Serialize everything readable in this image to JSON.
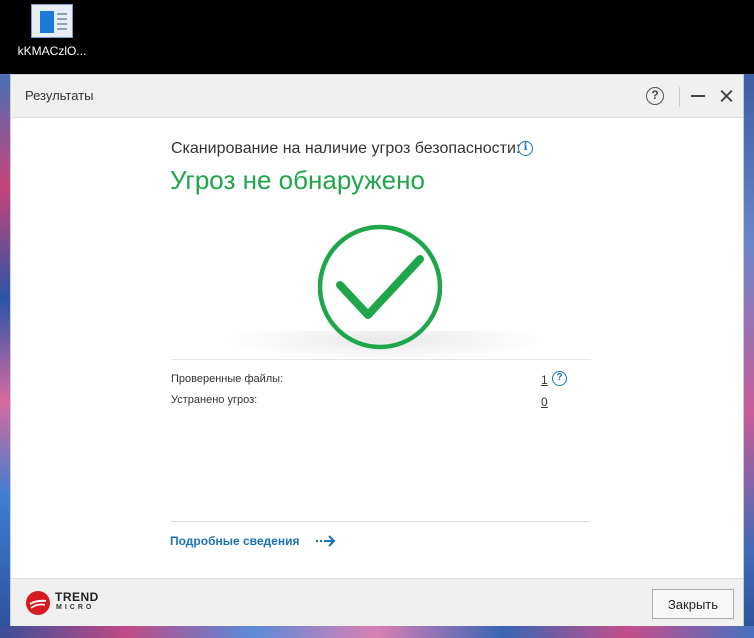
{
  "desktop": {
    "icon_label": "kKMACzlO..."
  },
  "window": {
    "title": "Результаты",
    "help_glyph": "?",
    "scan_label": "Сканирование на наличие угроз безопасности:",
    "info_glyph": "i",
    "result_title": "Угроз не обнаружено",
    "stats": [
      {
        "label": "Проверенные файлы:",
        "value": "1"
      },
      {
        "label": "Устранено угроз:",
        "value": "0"
      }
    ],
    "stat_help_glyph": "?",
    "details_link": "Подробные сведения",
    "logo": {
      "line1": "TREND",
      "line2": "MICRO"
    },
    "close_button": "Закрыть"
  },
  "colors": {
    "success_green": "#1fa64b",
    "link_blue": "#1a73b8",
    "brand_red": "#d71920"
  },
  "icons": [
    "window-app-icon",
    "help-icon",
    "minimize-icon",
    "close-icon",
    "info-icon",
    "checkmark-icon",
    "arrow-right-icon",
    "trend-micro-logo-icon"
  ]
}
